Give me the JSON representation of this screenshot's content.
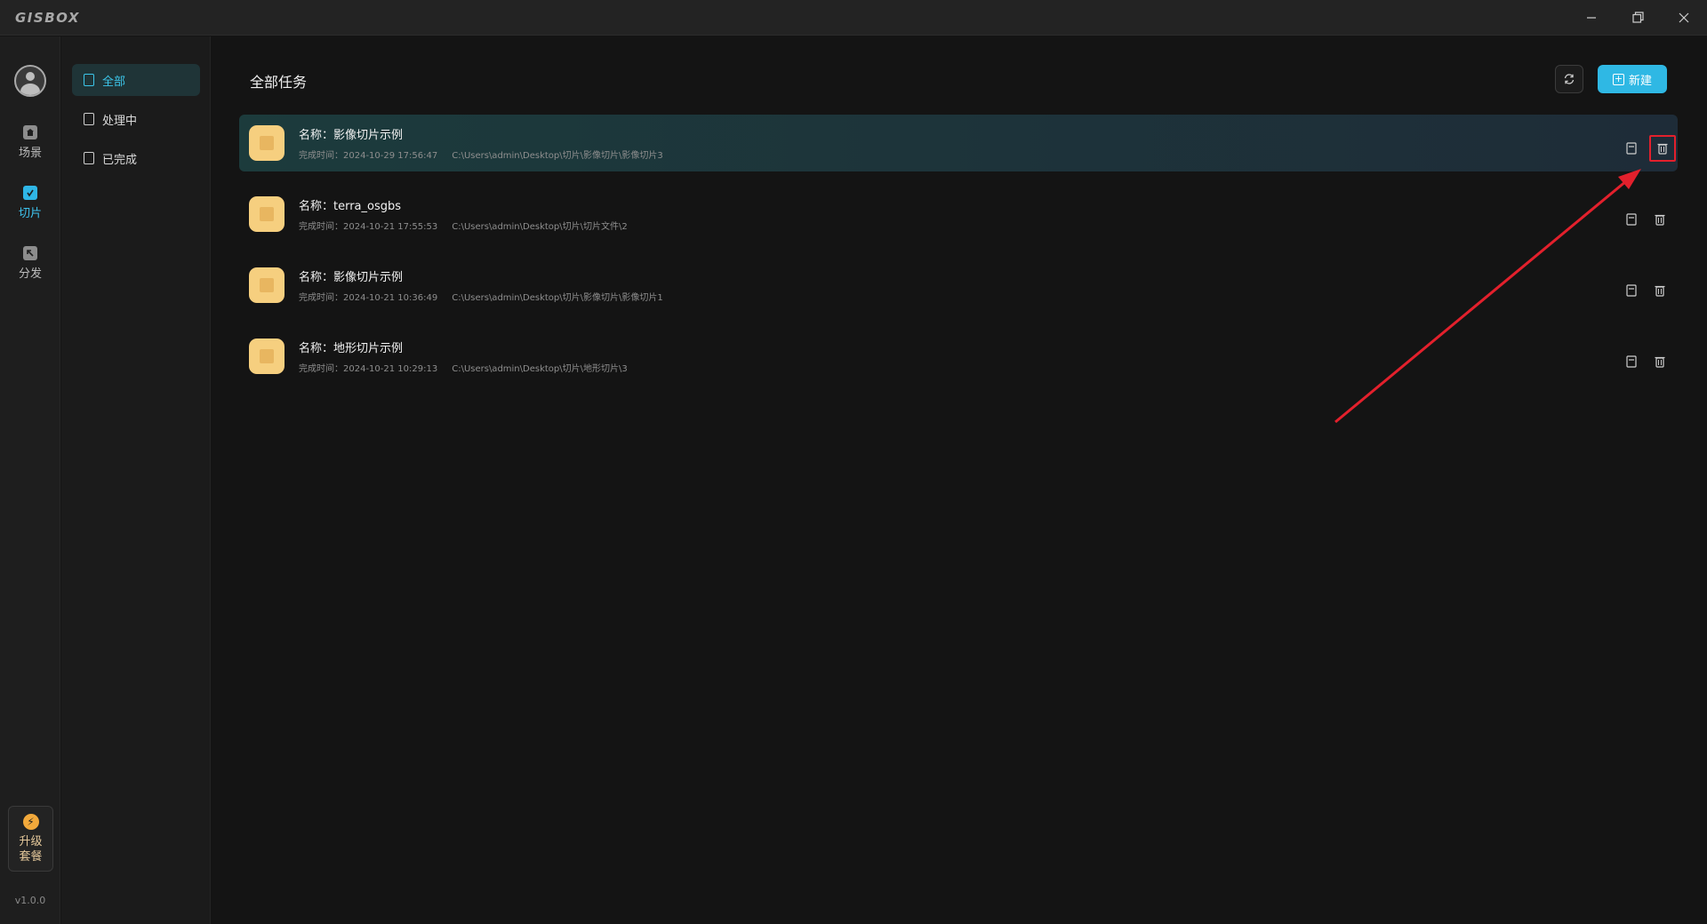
{
  "app": {
    "logo": "GISBOX",
    "version": "v1.0.0"
  },
  "rail": {
    "items": [
      {
        "label": "场景",
        "icon": "scene-icon"
      },
      {
        "label": "切片",
        "icon": "slice-icon"
      },
      {
        "label": "分发",
        "icon": "distribute-icon"
      }
    ],
    "upgrade": {
      "line1": "升级",
      "line2": "套餐",
      "icon": "bolt-icon"
    }
  },
  "subnav": {
    "items": [
      {
        "label": "全部"
      },
      {
        "label": "处理中"
      },
      {
        "label": "已完成"
      }
    ]
  },
  "main": {
    "title": "全部任务",
    "new_label": "新建"
  },
  "tasks": [
    {
      "name": "名称：影像切片示例",
      "time": "完成时间：2024-10-29 17:56:47",
      "path": "C:\\Users\\admin\\Desktop\\切片\\影像切片\\影像切片3"
    },
    {
      "name": "名称：terra_osgbs",
      "time": "完成时间：2024-10-21 17:55:53",
      "path": "C:\\Users\\admin\\Desktop\\切片\\切片文件\\2"
    },
    {
      "name": "名称：影像切片示例",
      "time": "完成时间：2024-10-21 10:36:49",
      "path": "C:\\Users\\admin\\Desktop\\切片\\影像切片\\影像切片1"
    },
    {
      "name": "名称：地形切片示例",
      "time": "完成时间：2024-10-21 10:29:13",
      "path": "C:\\Users\\admin\\Desktop\\切片\\地形切片\\3"
    }
  ],
  "colors": {
    "accent": "#2fb8e4",
    "annotation": "#e3202c",
    "thumb": "#f6cf7f"
  }
}
